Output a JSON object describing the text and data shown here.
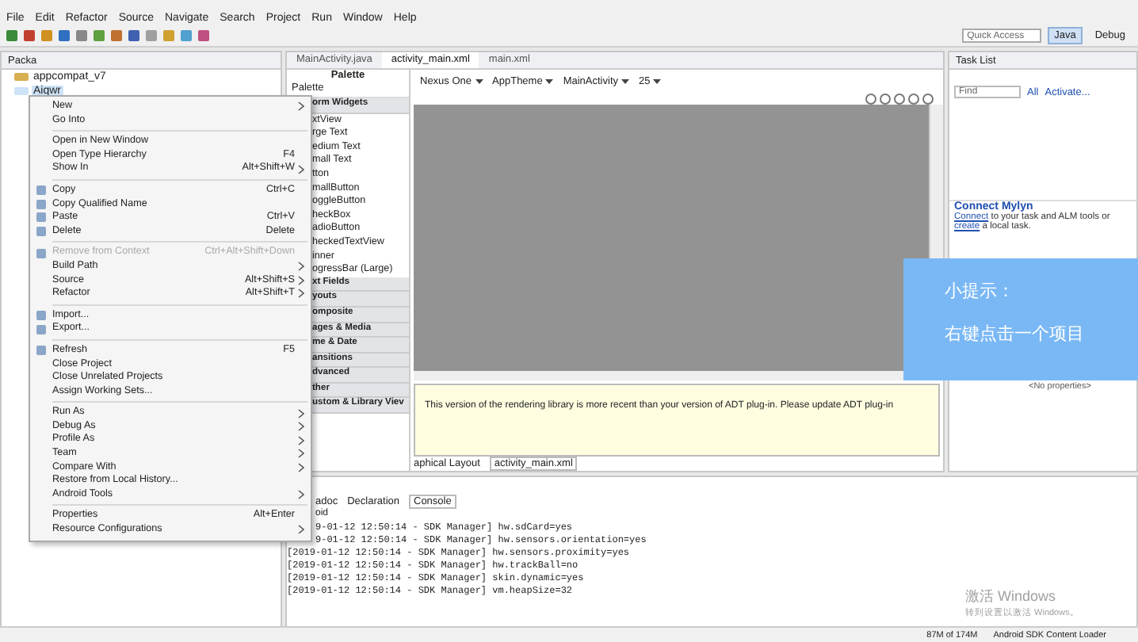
{
  "menu_bar": [
    "File",
    "Edit",
    "Refactor",
    "Source",
    "Navigate",
    "Search",
    "Project",
    "Run",
    "Window",
    "Help"
  ],
  "toolbar": {
    "quick_access": {
      "placeholder": "Quick Access"
    },
    "perspectives": [
      {
        "label": "Java",
        "selected": true
      },
      {
        "label": "Debug",
        "selected": false
      }
    ]
  },
  "package_explorer": {
    "title": "Packa",
    "items": [
      {
        "label": "appcompat_v7",
        "selected": false
      },
      {
        "label": "Aiqwr",
        "selected": true
      }
    ]
  },
  "editor_tabs": [
    {
      "label": "MainActivity.java",
      "selected": false
    },
    {
      "label": "activity_main.xml",
      "selected": true
    },
    {
      "label": "main.xml",
      "selected": false
    }
  ],
  "palette": {
    "title": "Palette",
    "filter": "Palette",
    "items": [
      {
        "label": "orm Widgets",
        "kind": "header"
      },
      {
        "label": "xtView",
        "kind": "item"
      },
      {
        "label": "rge Text",
        "kind": "item"
      },
      {
        "label": "edium Text",
        "kind": "item"
      },
      {
        "label": "mall Text",
        "kind": "item"
      },
      {
        "label": "tton",
        "kind": "item"
      },
      {
        "label": "mallButton",
        "kind": "item"
      },
      {
        "label": "oggleButton",
        "kind": "item"
      },
      {
        "label": "heckBox",
        "kind": "item"
      },
      {
        "label": "adioButton",
        "kind": "item"
      },
      {
        "label": "heckedTextView",
        "kind": "item"
      },
      {
        "label": "inner",
        "kind": "item"
      },
      {
        "label": "ogressBar (Large)",
        "kind": "item"
      },
      {
        "label": "xt Fields",
        "kind": "header"
      },
      {
        "label": "youts",
        "kind": "header"
      },
      {
        "label": "omposite",
        "kind": "header"
      },
      {
        "label": "ages & Media",
        "kind": "header"
      },
      {
        "label": "me & Date",
        "kind": "header"
      },
      {
        "label": "ansitions",
        "kind": "header"
      },
      {
        "label": "dvanced",
        "kind": "header"
      },
      {
        "label": "ther",
        "kind": "header"
      },
      {
        "label": "ustom & Library Viev",
        "kind": "header"
      }
    ]
  },
  "layout_toolbar": [
    "Nexus One",
    "AppTheme",
    "MainActivity",
    "25"
  ],
  "warning": "This version of the rendering library is more recent than your version of ADT plug-in. Please update ADT plug-in",
  "layout_tabs": [
    {
      "label": "aphical Layout",
      "selected": false
    },
    {
      "label": "activity_main.xml",
      "selected": true
    }
  ],
  "task_list": {
    "title": "Task List",
    "find": {
      "placeholder": "Find"
    },
    "filters": [
      "All",
      "Activate..."
    ]
  },
  "mylyn": {
    "title": "Connect Mylyn",
    "link_connect": "Connect",
    "text_1": "to your task and ALM tools or",
    "link_create": "create",
    "text_2": "a local task."
  },
  "properties": {
    "empty": "<No properties>"
  },
  "console": {
    "tabs": [
      {
        "label": "adoc",
        "selected": false
      },
      {
        "label": "Declaration",
        "selected": false
      },
      {
        "label": "Console",
        "selected": true
      }
    ],
    "name": "oid",
    "lines": [
      "9-01-12 12:50:14 - SDK Manager] hw.sdCard=yes",
      "9-01-12 12:50:14 - SDK Manager] hw.sensors.orientation=yes",
      "[2019-01-12 12:50:14 - SDK Manager] hw.sensors.proximity=yes",
      "[2019-01-12 12:50:14 - SDK Manager] hw.trackBall=no",
      "[2019-01-12 12:50:14 - SDK Manager] skin.dynamic=yes",
      "[2019-01-12 12:50:14 - SDK Manager] vm.heapSize=32"
    ]
  },
  "activation": {
    "title": "激活 Windows",
    "subtitle": "转到设置以激活 Windows。"
  },
  "status_bar": {
    "heap": "87M of 174M",
    "task": "Android SDK Content Loader"
  },
  "context_menu": [
    {
      "kind": "item",
      "label": "New",
      "submenu": true,
      "disabled": false,
      "icon": false
    },
    {
      "kind": "item",
      "label": "Go Into",
      "submenu": false,
      "disabled": false,
      "icon": false
    },
    {
      "kind": "separator"
    },
    {
      "kind": "item",
      "label": "Open in New Window",
      "submenu": false,
      "disabled": false,
      "icon": false
    },
    {
      "kind": "item",
      "label": "Open Type Hierarchy",
      "shortcut": "F4",
      "submenu": false,
      "disabled": false,
      "icon": false
    },
    {
      "kind": "item",
      "label": "Show In",
      "shortcut": "Alt+Shift+W",
      "submenu": true,
      "disabled": false,
      "icon": false
    },
    {
      "kind": "separator"
    },
    {
      "kind": "item",
      "label": "Copy",
      "shortcut": "Ctrl+C",
      "submenu": false,
      "disabled": false,
      "icon": true
    },
    {
      "kind": "item",
      "label": "Copy Qualified Name",
      "submenu": false,
      "disabled": false,
      "icon": true
    },
    {
      "kind": "item",
      "label": "Paste",
      "shortcut": "Ctrl+V",
      "submenu": false,
      "disabled": false,
      "icon": true
    },
    {
      "kind": "item",
      "label": "Delete",
      "shortcut": "Delete",
      "submenu": false,
      "disabled": false,
      "icon": true
    },
    {
      "kind": "separator"
    },
    {
      "kind": "item",
      "label": "Remove from Context",
      "shortcut": "Ctrl+Alt+Shift+Down",
      "submenu": false,
      "disabled": true,
      "icon": true
    },
    {
      "kind": "item",
      "label": "Build Path",
      "submenu": true,
      "disabled": false,
      "icon": false
    },
    {
      "kind": "item",
      "label": "Source",
      "shortcut": "Alt+Shift+S",
      "submenu": true,
      "disabled": false,
      "icon": false
    },
    {
      "kind": "item",
      "label": "Refactor",
      "shortcut": "Alt+Shift+T",
      "submenu": true,
      "disabled": false,
      "icon": false
    },
    {
      "kind": "separator"
    },
    {
      "kind": "item",
      "label": "Import...",
      "submenu": false,
      "disabled": false,
      "icon": true
    },
    {
      "kind": "item",
      "label": "Export...",
      "submenu": false,
      "disabled": false,
      "icon": true
    },
    {
      "kind": "separator"
    },
    {
      "kind": "item",
      "label": "Refresh",
      "shortcut": "F5",
      "submenu": false,
      "disabled": false,
      "icon": true
    },
    {
      "kind": "item",
      "label": "Close Project",
      "submenu": false,
      "disabled": false,
      "icon": false
    },
    {
      "kind": "item",
      "label": "Close Unrelated Projects",
      "submenu": false,
      "disabled": false,
      "icon": false
    },
    {
      "kind": "item",
      "label": "Assign Working Sets...",
      "submenu": false,
      "disabled": false,
      "icon": false
    },
    {
      "kind": "separator"
    },
    {
      "kind": "item",
      "label": "Run As",
      "submenu": true,
      "disabled": false,
      "icon": false
    },
    {
      "kind": "item",
      "label": "Debug As",
      "submenu": true,
      "disabled": false,
      "icon": false
    },
    {
      "kind": "item",
      "label": "Profile As",
      "submenu": true,
      "disabled": false,
      "icon": false
    },
    {
      "kind": "item",
      "label": "Team",
      "submenu": true,
      "disabled": false,
      "icon": false
    },
    {
      "kind": "item",
      "label": "Compare With",
      "submenu": true,
      "disabled": false,
      "icon": false
    },
    {
      "kind": "item",
      "label": "Restore from Local History...",
      "submenu": false,
      "disabled": false,
      "icon": false
    },
    {
      "kind": "item",
      "label": "Android Tools",
      "submenu": true,
      "disabled": false,
      "icon": false
    },
    {
      "kind": "separator"
    },
    {
      "kind": "item",
      "label": "Properties",
      "shortcut": "Alt+Enter",
      "submenu": false,
      "disabled": false,
      "icon": false
    },
    {
      "kind": "item",
      "label": "Resource Configurations",
      "submenu": true,
      "disabled": false,
      "icon": false
    }
  ],
  "tip": {
    "title": "小提示：",
    "text": "右键点击一个项目"
  }
}
